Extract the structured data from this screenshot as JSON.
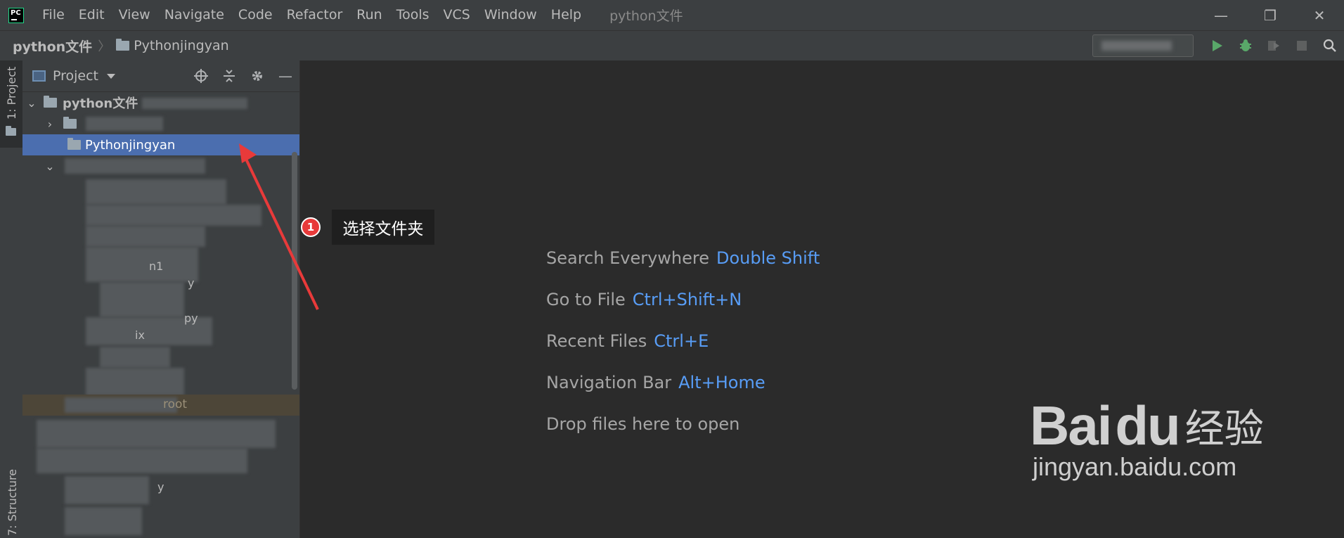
{
  "app": {
    "logo_text": "PC",
    "window_title": "python文件"
  },
  "menu": [
    {
      "label": "File"
    },
    {
      "label": "Edit"
    },
    {
      "label": "View"
    },
    {
      "label": "Navigate"
    },
    {
      "label": "Code"
    },
    {
      "label": "Refactor"
    },
    {
      "label": "Run"
    },
    {
      "label": "Tools"
    },
    {
      "label": "VCS"
    },
    {
      "label": "Window"
    },
    {
      "label": "Help"
    }
  ],
  "breadcrumb": {
    "root": "python文件",
    "item": "Pythonjingyan"
  },
  "side_tabs": {
    "project": "1: Project",
    "structure": "7: Structure"
  },
  "project_panel": {
    "title": "Project",
    "tree": {
      "root": "python文件",
      "selected": "Pythonjingyan",
      "partial_texts": [
        "n1",
        "y",
        "py",
        "ix",
        "root",
        "y"
      ]
    }
  },
  "welcome": {
    "items": [
      {
        "label": "Search Everywhere",
        "key": "Double Shift"
      },
      {
        "label": "Go to File",
        "key": "Ctrl+Shift+N"
      },
      {
        "label": "Recent Files",
        "key": "Ctrl+E"
      },
      {
        "label": "Navigation Bar",
        "key": "Alt+Home"
      }
    ],
    "drop_text": "Drop files here to open"
  },
  "annotation": {
    "number": "1",
    "text": "选择文件夹"
  },
  "watermark": {
    "brand": "Bai",
    "brand2": "du",
    "cn": "经验",
    "url": "jingyan.baidu.com"
  },
  "colors": {
    "accent": "#589df6",
    "selection": "#4b6eaf",
    "annotation_red": "#e83a3a",
    "run_green": "#59a869"
  }
}
